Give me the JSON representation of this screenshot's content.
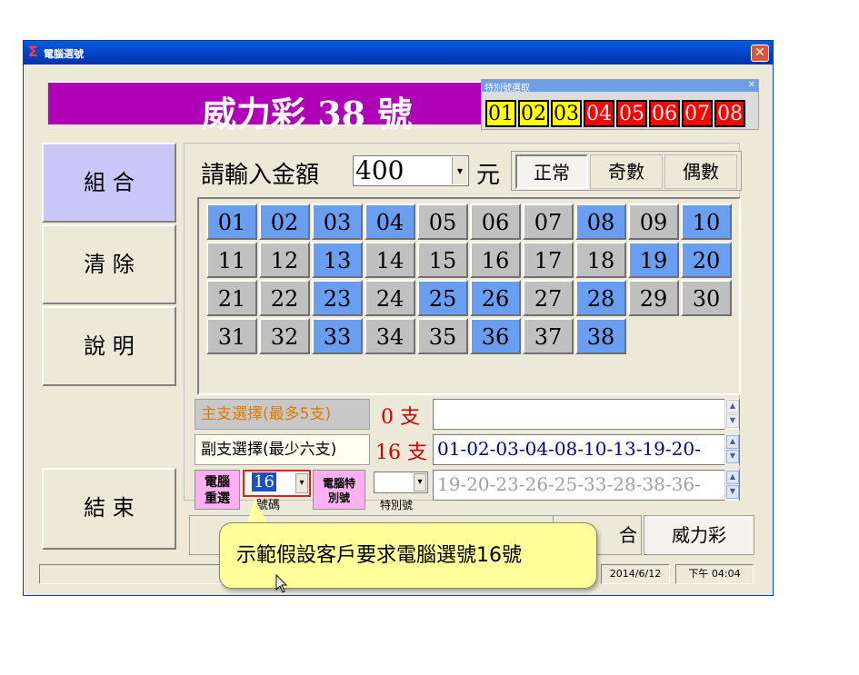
{
  "window": {
    "title": "電腦選號",
    "close_glyph": "✕"
  },
  "banner": {
    "text": "威力彩  38  號"
  },
  "special_popup": {
    "title": "特別號選取",
    "close_glyph": "✕",
    "numbers": [
      {
        "n": "01",
        "color": "#ffff00",
        "text_color": "#000000"
      },
      {
        "n": "02",
        "color": "#ffff00",
        "text_color": "#000000"
      },
      {
        "n": "03",
        "color": "#ffff00",
        "text_color": "#000000"
      },
      {
        "n": "04",
        "color": "#ff0000",
        "text_color": "#ffffff"
      },
      {
        "n": "05",
        "color": "#ff0000",
        "text_color": "#ffffff"
      },
      {
        "n": "06",
        "color": "#ff0000",
        "text_color": "#ffffff"
      },
      {
        "n": "07",
        "color": "#ff0000",
        "text_color": "#ffffff"
      },
      {
        "n": "08",
        "color": "#ff0000",
        "text_color": "#ffffff"
      }
    ]
  },
  "sidebar": {
    "combine": "組 合",
    "clear": "清 除",
    "help": "說 明",
    "exit": "結 束"
  },
  "amount": {
    "label": "請輸入金額",
    "value": "400",
    "unit": "元"
  },
  "modes": {
    "normal": "正常",
    "odd": "奇數",
    "even": "偶數"
  },
  "numbers": [
    {
      "n": "01",
      "sel": true
    },
    {
      "n": "02",
      "sel": true
    },
    {
      "n": "03",
      "sel": true
    },
    {
      "n": "04",
      "sel": true
    },
    {
      "n": "05",
      "sel": false
    },
    {
      "n": "06",
      "sel": false
    },
    {
      "n": "07",
      "sel": false
    },
    {
      "n": "08",
      "sel": true
    },
    {
      "n": "09",
      "sel": false
    },
    {
      "n": "10",
      "sel": true
    },
    {
      "n": "11",
      "sel": false
    },
    {
      "n": "12",
      "sel": false
    },
    {
      "n": "13",
      "sel": true
    },
    {
      "n": "14",
      "sel": false
    },
    {
      "n": "15",
      "sel": false
    },
    {
      "n": "16",
      "sel": false
    },
    {
      "n": "17",
      "sel": false
    },
    {
      "n": "18",
      "sel": false
    },
    {
      "n": "19",
      "sel": true
    },
    {
      "n": "20",
      "sel": true
    },
    {
      "n": "21",
      "sel": false
    },
    {
      "n": "22",
      "sel": false
    },
    {
      "n": "23",
      "sel": true
    },
    {
      "n": "24",
      "sel": false
    },
    {
      "n": "25",
      "sel": true
    },
    {
      "n": "26",
      "sel": true
    },
    {
      "n": "27",
      "sel": false
    },
    {
      "n": "28",
      "sel": true
    },
    {
      "n": "29",
      "sel": false
    },
    {
      "n": "30",
      "sel": false
    },
    {
      "n": "31",
      "sel": false
    },
    {
      "n": "32",
      "sel": false
    },
    {
      "n": "33",
      "sel": true
    },
    {
      "n": "34",
      "sel": false
    },
    {
      "n": "35",
      "sel": false
    },
    {
      "n": "36",
      "sel": true
    },
    {
      "n": "37",
      "sel": false
    },
    {
      "n": "38",
      "sel": true
    }
  ],
  "main_select": {
    "label": "主支選擇(最多5支)",
    "count": "0 支",
    "value": ""
  },
  "sub_select": {
    "label": "副支選擇(最少六支)",
    "count": "16 支",
    "value": "01-02-03-04-08-10-13-19-20-"
  },
  "pc_row": {
    "pc_pick": "電腦\n重選",
    "count_value": "16",
    "count_label": "號碼",
    "pc_special": "電腦特\n別號",
    "special_label": "特別號",
    "special_value": "",
    "result": "19-20-23-26-25-33-28-38-36-"
  },
  "bottom_tabs": {
    "combo": "合",
    "power": "威力彩"
  },
  "status": {
    "date": "2014/6/12",
    "time": "下午 04:04"
  },
  "tooltip": {
    "text": "示範假設客戶要求電腦選號16號"
  },
  "colors": {
    "selected_number": "#6a9ef0",
    "unselected_number": "#c0c0c0",
    "banner": "#b000b8"
  }
}
